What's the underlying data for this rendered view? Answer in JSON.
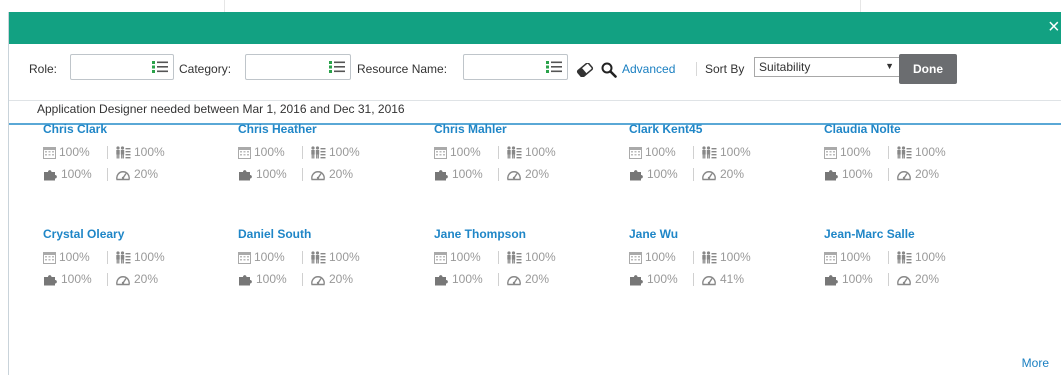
{
  "colors": {
    "header": "#12a182",
    "link": "#1a7fc1",
    "name": "#1f86c7",
    "done": "#6b6d70",
    "metric": "#999999"
  },
  "dialog": {
    "close_glyph": "×"
  },
  "filters": {
    "role_label": "Role:",
    "category_label": "Category:",
    "resource_name_label": "Resource Name:",
    "advanced_link": "Advanced",
    "sort_by_label": "Sort By",
    "sort_value": "Suitability",
    "done_label": "Done"
  },
  "info_text": "Application Designer needed between Mar 1, 2016 and Dec 31, 2016",
  "resources": [
    {
      "name": "Chris Clark",
      "availability": "100%",
      "role_match": "100%",
      "skills": "100%",
      "utilization": "20%"
    },
    {
      "name": "Chris Heather",
      "availability": "100%",
      "role_match": "100%",
      "skills": "100%",
      "utilization": "20%"
    },
    {
      "name": "Chris Mahler",
      "availability": "100%",
      "role_match": "100%",
      "skills": "100%",
      "utilization": "20%"
    },
    {
      "name": "Clark Kent45",
      "availability": "100%",
      "role_match": "100%",
      "skills": "100%",
      "utilization": "20%"
    },
    {
      "name": "Claudia Nolte",
      "availability": "100%",
      "role_match": "100%",
      "skills": "100%",
      "utilization": "20%"
    },
    {
      "name": "Crystal Oleary",
      "availability": "100%",
      "role_match": "100%",
      "skills": "100%",
      "utilization": "20%"
    },
    {
      "name": "Daniel South",
      "availability": "100%",
      "role_match": "100%",
      "skills": "100%",
      "utilization": "20%"
    },
    {
      "name": "Jane Thompson",
      "availability": "100%",
      "role_match": "100%",
      "skills": "100%",
      "utilization": "20%"
    },
    {
      "name": "Jane Wu",
      "availability": "100%",
      "role_match": "100%",
      "skills": "100%",
      "utilization": "41%"
    },
    {
      "name": "Jean-Marc Salle",
      "availability": "100%",
      "role_match": "100%",
      "skills": "100%",
      "utilization": "20%"
    }
  ],
  "more_link": "More"
}
